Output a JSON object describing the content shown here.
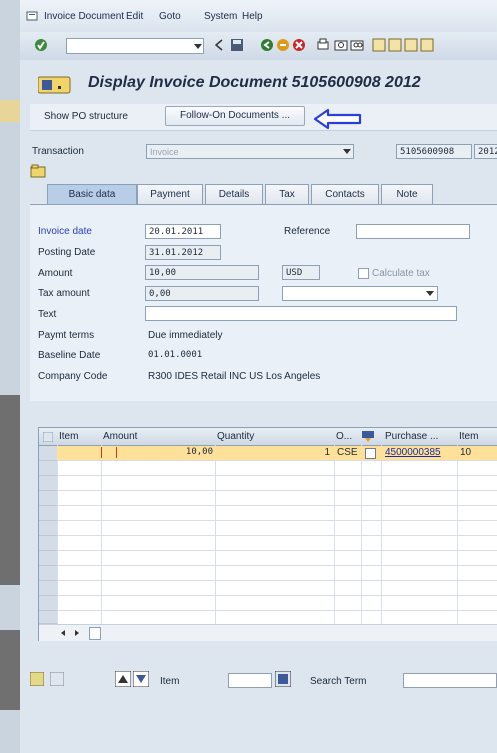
{
  "menu": {
    "items": [
      "Invoice Document",
      "Edit",
      "Goto",
      "System",
      "Help"
    ]
  },
  "title": "Display Invoice Document 5105600908 2012",
  "appbar": {
    "show_po": "Show PO structure",
    "follow_on": "Follow-On Documents ..."
  },
  "transaction": {
    "label": "Transaction",
    "value": "Invoice",
    "doc_no": "5105600908",
    "year": "2012"
  },
  "tabs": [
    "Basic data",
    "Payment",
    "Details",
    "Tax",
    "Contacts",
    "Note"
  ],
  "basic": {
    "invoice_date_label": "Invoice date",
    "invoice_date": "20.01.2011",
    "reference_label": "Reference",
    "posting_date_label": "Posting Date",
    "posting_date": "31.01.2012",
    "amount_label": "Amount",
    "amount": "10,00",
    "currency": "USD",
    "calc_tax_label": "Calculate tax",
    "tax_amount_label": "Tax amount",
    "tax_amount": "0,00",
    "text_label": "Text",
    "payt_terms_label": "Paymt terms",
    "payt_terms": "Due immediately",
    "baseline_label": "Baseline Date",
    "baseline": "01.01.0001",
    "company_label": "Company Code",
    "company": "R300 IDES Retail INC US Los Angeles"
  },
  "grid": {
    "headers": [
      "Item",
      "Amount",
      "Quantity",
      "O...",
      "Purchase ...",
      "Item"
    ],
    "row1": {
      "amount": "10,00",
      "quantity": "1",
      "unit": "CSE",
      "po": "4500000385",
      "item": "10"
    }
  },
  "bottom": {
    "item_label": "Item",
    "search_label": "Search Term"
  },
  "colors": {
    "accent_arrow": "#2a3fd6",
    "selected_row": "#fde09a"
  }
}
